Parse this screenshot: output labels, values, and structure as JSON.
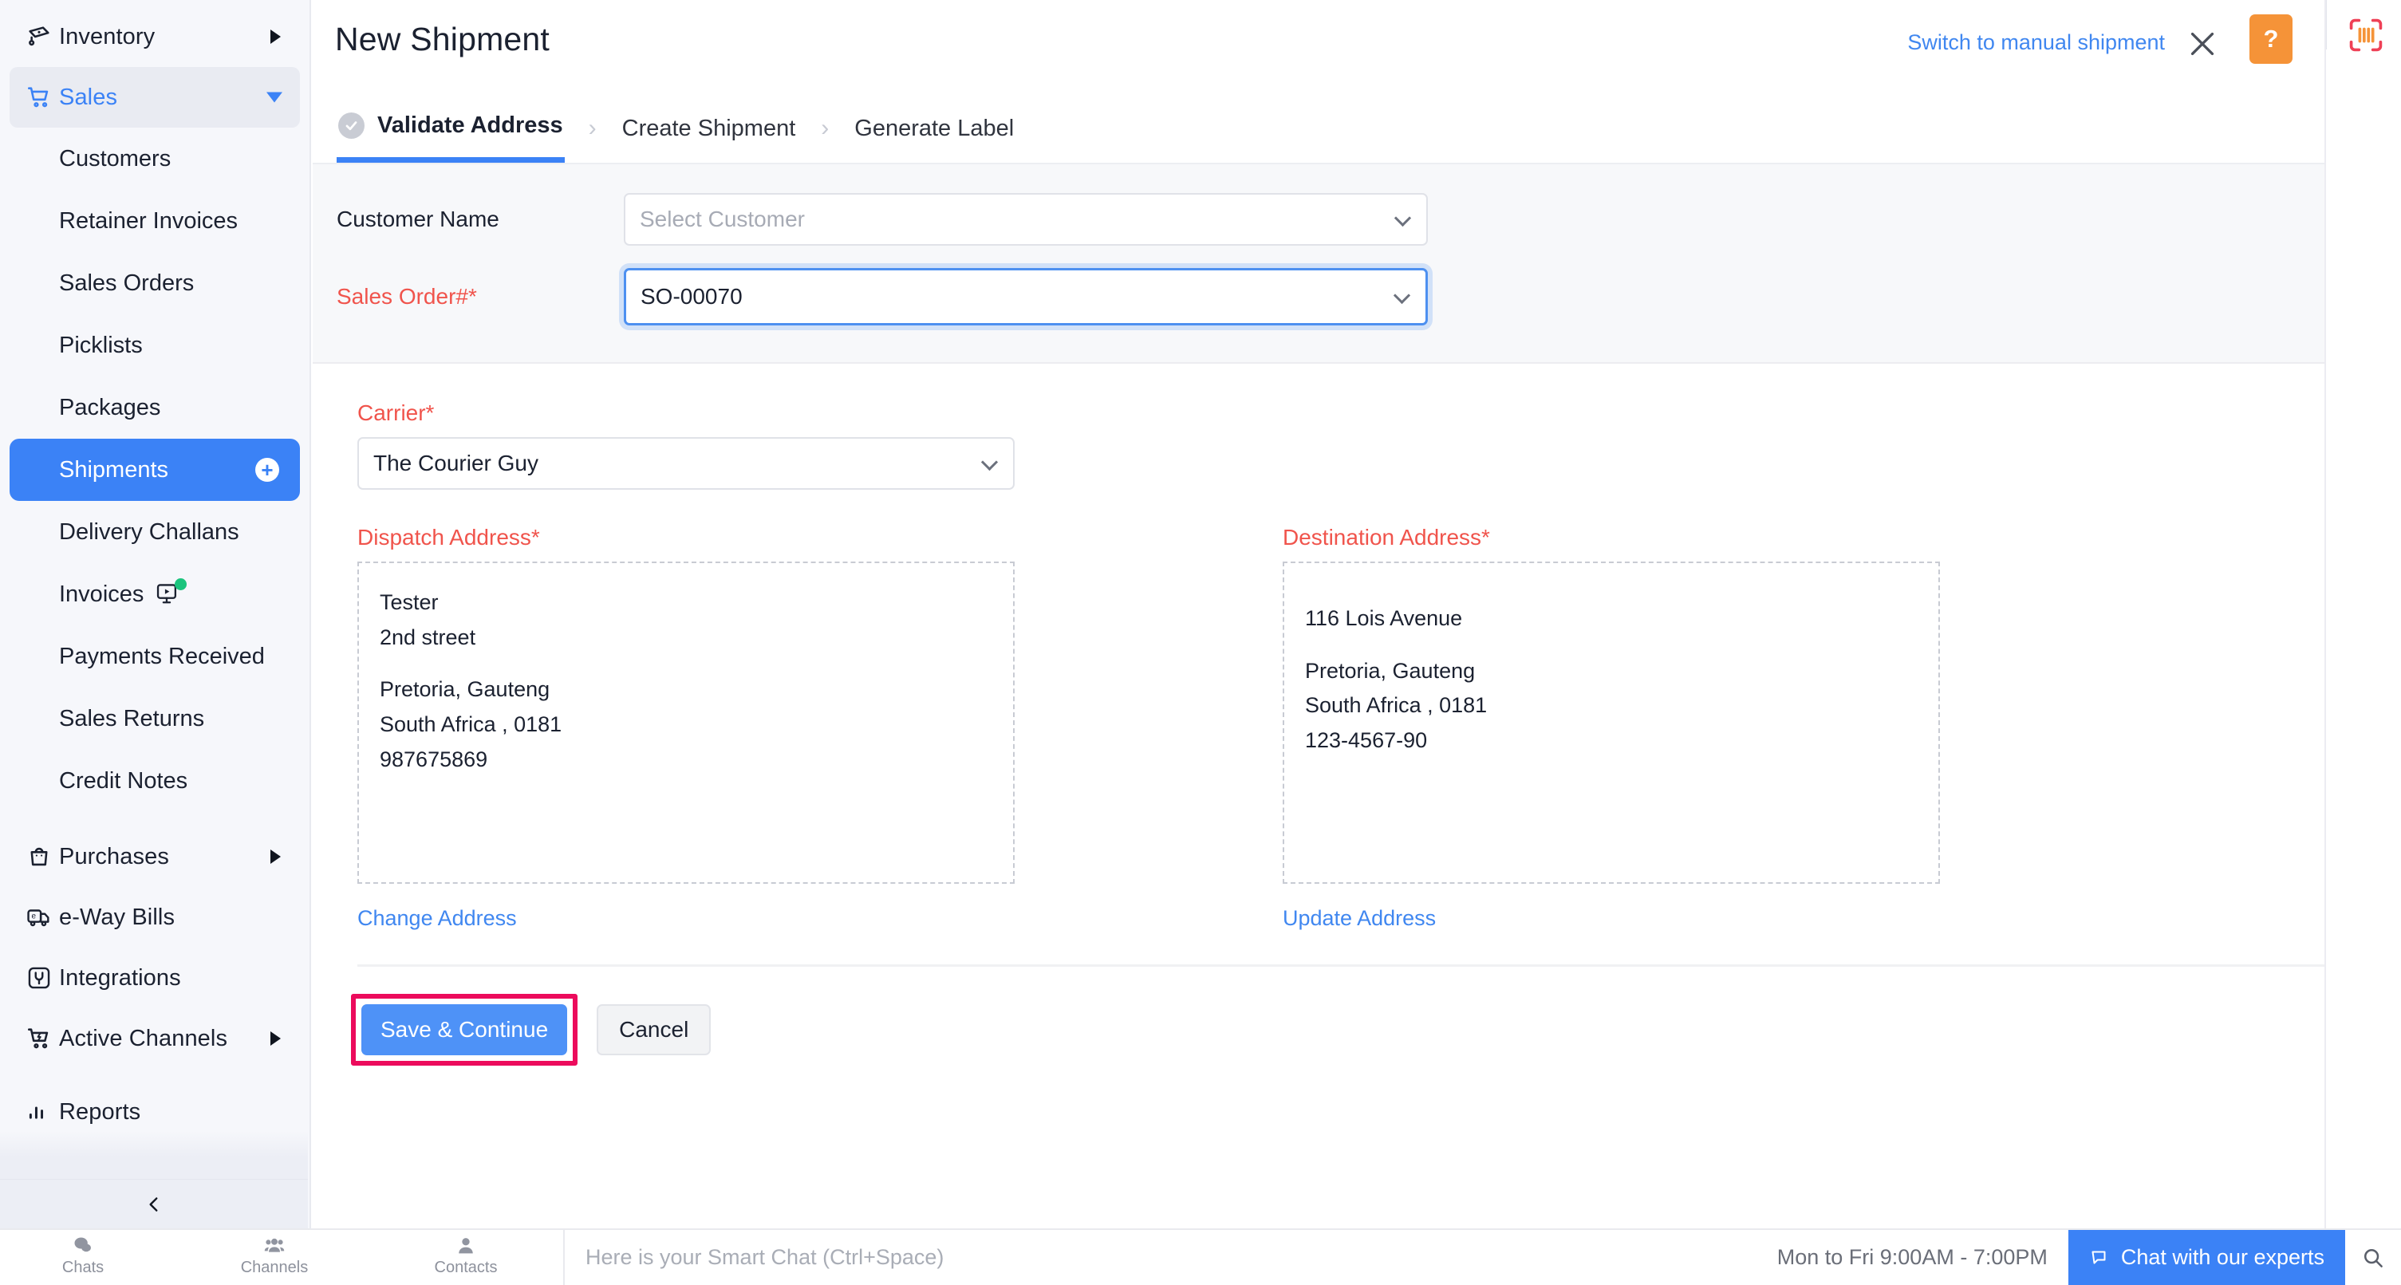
{
  "sidebar": {
    "items": [
      {
        "label": "Inventory",
        "icon": "inventory-icon",
        "type": "group",
        "state": "collapsed"
      },
      {
        "label": "Sales",
        "icon": "cart-icon",
        "type": "group",
        "state": "expanded"
      },
      {
        "label": "Customers",
        "type": "sub"
      },
      {
        "label": "Retainer Invoices",
        "type": "sub"
      },
      {
        "label": "Sales Orders",
        "type": "sub"
      },
      {
        "label": "Picklists",
        "type": "sub"
      },
      {
        "label": "Packages",
        "type": "sub"
      },
      {
        "label": "Shipments",
        "type": "sub",
        "active": true,
        "badge": "+"
      },
      {
        "label": "Delivery Challans",
        "type": "sub"
      },
      {
        "label": "Invoices",
        "type": "sub",
        "trailing_icon": "video-badge-icon"
      },
      {
        "label": "Payments Received",
        "type": "sub"
      },
      {
        "label": "Sales Returns",
        "type": "sub"
      },
      {
        "label": "Credit Notes",
        "type": "sub"
      },
      {
        "label": "Purchases",
        "icon": "bag-icon",
        "type": "group",
        "state": "collapsed"
      },
      {
        "label": "e-Way Bills",
        "icon": "eway-truck-icon",
        "type": "item"
      },
      {
        "label": "Integrations",
        "icon": "plug-icon",
        "type": "item"
      },
      {
        "label": "Active Channels",
        "icon": "channel-cart-icon",
        "type": "group",
        "state": "collapsed"
      },
      {
        "label": "Reports",
        "icon": "bar-chart-icon",
        "type": "item"
      }
    ],
    "collapse_tooltip": "Collapse sidebar"
  },
  "header": {
    "title": "New Shipment",
    "switch_link": "Switch to manual shipment",
    "help_label": "?"
  },
  "steps": [
    {
      "label": "Validate Address",
      "state": "current-done"
    },
    {
      "label": "Create Shipment",
      "state": "upcoming"
    },
    {
      "label": "Generate Label",
      "state": "upcoming"
    }
  ],
  "step_separator": "›",
  "form": {
    "customer_name": {
      "label": "Customer Name",
      "placeholder": "Select Customer",
      "value": ""
    },
    "sales_order": {
      "label": "Sales Order#*",
      "value": "SO-00070",
      "required": true,
      "focused": true
    },
    "carrier": {
      "label": "Carrier*",
      "value": "The Courier Guy",
      "required": true
    },
    "dispatch_address": {
      "label": "Dispatch Address*",
      "lines": [
        "Tester",
        "2nd street",
        "",
        "Pretoria, Gauteng",
        "South Africa , 0181",
        "987675869"
      ],
      "link": "Change Address"
    },
    "destination_address": {
      "label": "Destination Address*",
      "lines": [
        "116 Lois Avenue",
        "",
        "Pretoria, Gauteng",
        "South Africa , 0181",
        "123-4567-90"
      ],
      "link": "Update Address"
    }
  },
  "actions": {
    "save_label": "Save & Continue",
    "cancel_label": "Cancel"
  },
  "taskbar": {
    "items": [
      {
        "label": "Chats",
        "icon": "chat-bubbles-icon"
      },
      {
        "label": "Channels",
        "icon": "people-group-icon"
      },
      {
        "label": "Contacts",
        "icon": "person-icon"
      }
    ],
    "smart_chat_placeholder": "Here is your Smart Chat (Ctrl+Space)",
    "hours": "Mon to Fri 9:00AM - 7:00PM",
    "chat_experts": "Chat with our experts"
  },
  "colors": {
    "accent_blue": "#3b82f6",
    "link_blue": "#4087f0",
    "required_red": "#f0544c",
    "highlight_pink": "#ec0b5c",
    "help_orange": "#f59338",
    "badge_green": "#1bc47d",
    "barcode_red": "#ef4056",
    "sidebar_bg": "#f6f7fb",
    "band_bg": "#f7f8fa"
  }
}
